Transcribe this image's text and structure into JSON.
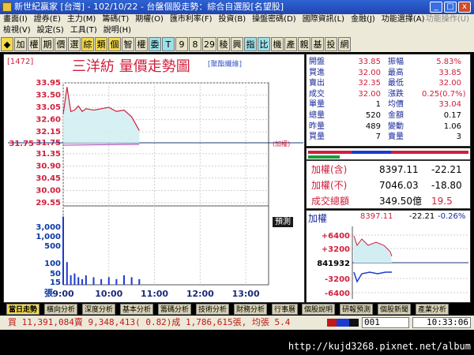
{
  "window": {
    "title": "新世紀贏家 [台灣] - 102/10/22 - 台盤個股走勢：綜合自選股[名望股]",
    "buttons": [
      "_",
      "□",
      "x"
    ]
  },
  "menu1": [
    "畫面(I)",
    "證券(E)",
    "主力(M)",
    "籌碼(T)",
    "期權(O)",
    "匯市利率(F)",
    "投資(B)",
    "操盤密碼(D)",
    "國際資訊(L)",
    "金融(J)",
    "功能選擇(A)"
  ],
  "menu1_right": "功能操作(U)",
  "menu2": [
    "檢視(V)",
    "設定(S)",
    "工具(T)",
    "說明(H)"
  ],
  "toolbar": [
    "◆",
    "加",
    "權",
    "期",
    "價",
    "選",
    "綜",
    "類",
    "個",
    "智",
    "權",
    "委",
    "T",
    "9",
    "8",
    "29",
    "稜",
    "興",
    "指",
    "比",
    "機",
    "產",
    "親",
    "基",
    "投",
    "網"
  ],
  "stock": {
    "code": "[1472]",
    "name": "三洋紡 量價走勢圖",
    "industry": "[聚酯纖維]"
  },
  "chart": {
    "price_ticks": [
      "33.95",
      "33.50",
      "33.05",
      "32.60",
      "32.15",
      "31.75",
      "31.35",
      "30.90",
      "30.45",
      "30.00",
      "29.55"
    ],
    "volume_ticks": [
      "3,000",
      "1,000",
      "500",
      "100",
      "50",
      "15"
    ],
    "volume_unit": "張",
    "time_ticks": [
      "9:00",
      "10:00",
      "11:00",
      "12:00",
      "13:00"
    ],
    "ref_label": "(加權)",
    "preview_label": "預測"
  },
  "chart_data": {
    "type": "line",
    "x": [
      "9:00",
      "9:05",
      "9:10",
      "9:15",
      "9:20",
      "9:25",
      "9:30",
      "9:40",
      "9:50",
      "10:00",
      "10:10",
      "10:20",
      "10:30",
      "10:40"
    ],
    "series": [
      {
        "values": [
          32.8,
          33.8,
          32.9,
          32.95,
          33.1,
          32.9,
          33.0,
          32.95,
          33.0,
          33.05,
          32.9,
          32.95,
          32.7,
          32.2
        ]
      }
    ],
    "reference": 31.75,
    "ylim": [
      29.55,
      33.95
    ],
    "volume": [
      180,
      60,
      25,
      30,
      20,
      15,
      25,
      20,
      15,
      20,
      15,
      25,
      20,
      15
    ],
    "xlim": [
      "9:00",
      "13:30"
    ],
    "grid": true
  },
  "quote": {
    "rows": [
      {
        "l1": "開盤",
        "v1": "33.85",
        "l2": "振幅",
        "v2": "5.83%"
      },
      {
        "l1": "買進",
        "v1": "32.00",
        "l2": "最高",
        "v2": "33.85"
      },
      {
        "l1": "賣出",
        "v1": "32.35",
        "l2": "最低",
        "v2": "32.00"
      },
      {
        "l1": "成交",
        "v1": "32.00",
        "l2": "漲跌",
        "v2": "0.25(0.7%)"
      },
      {
        "l1": "單量",
        "v1": "1",
        "l2": "均價",
        "v2": "33.04"
      },
      {
        "l1": "總量",
        "v1": "520",
        "l2": "金額",
        "v2": "0.17"
      },
      {
        "l1": "昨量",
        "v1": "489",
        "l2": "變動",
        "v2": "1.06"
      },
      {
        "l1": "買量",
        "v1": "7",
        "l2": "賣量",
        "v2": "3"
      }
    ]
  },
  "index": {
    "rows": [
      {
        "label": "加權(含)",
        "value": "8397.11",
        "change": "-22.21"
      },
      {
        "label": "加權(不)",
        "value": "7046.03",
        "change": "-18.80"
      },
      {
        "label": "成交總額",
        "value": "349.50億",
        "change": "19.5"
      }
    ]
  },
  "mini": {
    "title": "加權",
    "value": "8397.11",
    "change": "-22.21",
    "pct": "-0.26%",
    "ticks": [
      "+6400",
      "+3200",
      "841932",
      "-3200",
      "-6400"
    ]
  },
  "tabs": [
    "當日走勢",
    "橫向分析",
    "深度分析",
    "基本分析",
    "籌碼分析",
    "技術分析",
    "財務分析",
    "行事曆",
    "個股說明",
    "研報預測",
    "個股新聞",
    "產業分析"
  ],
  "status": {
    "summary": "買 11,391,084賣 9,348,413( 0.82)成 1,786,615張, 均張 5.4",
    "code": "001",
    "clock": "10:33:06"
  },
  "footer_url": "http://kujd3268.pixnet.net/album"
}
